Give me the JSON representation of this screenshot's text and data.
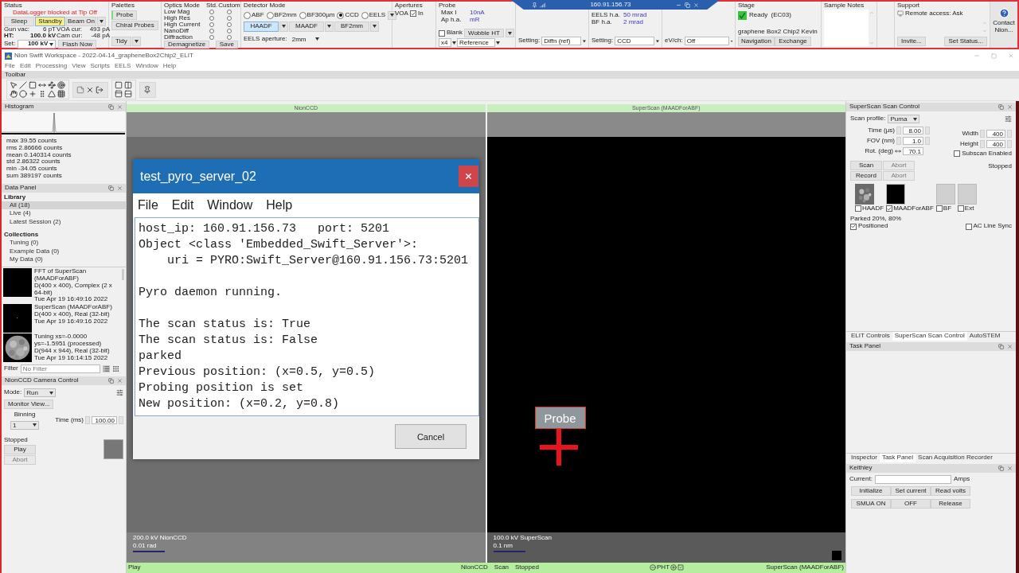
{
  "ribbon": {
    "status": {
      "title": "Status",
      "warning": "DataLogger blocked at Tip Off",
      "buttons": [
        {
          "label": "Sleep",
          "selected": false
        },
        {
          "label": "Standby",
          "selected": true
        },
        {
          "label": "Beam On",
          "selected": false
        }
      ],
      "readings": [
        {
          "label": "Gun vac:",
          "value": "6 pT",
          "bold": false
        },
        {
          "label": "VOA cur:",
          "value": "493 pA",
          "bold": false
        },
        {
          "label": "HT:",
          "value": "100.0 kV",
          "bold": true
        },
        {
          "label": "Cam cur:",
          "value": "-48 pA",
          "bold": false
        }
      ],
      "set_label": "Set:",
      "set_value": "100 kV",
      "flash": "Flash Now"
    },
    "palettes": {
      "title": "Palettes",
      "buttons": [
        "Probe",
        "Chiral Probes"
      ],
      "tidy": "Tidy"
    },
    "optics": {
      "title": "Optics Mode",
      "std": "Std.",
      "custom": "Custom",
      "modes": [
        {
          "label": "Low Mag",
          "std": false,
          "custom": false
        },
        {
          "label": "High Res",
          "std": false,
          "custom": false
        },
        {
          "label": "High Current",
          "std": false,
          "custom": false
        },
        {
          "label": "NanoDiff",
          "std": false,
          "custom": false
        },
        {
          "label": "Diffraction",
          "std": false,
          "custom": false
        }
      ],
      "buttons": [
        "Demagnetize",
        "Save"
      ]
    },
    "detector": {
      "title": "Detector Mode",
      "options": [
        {
          "label": "ABF",
          "selected": false
        },
        {
          "label": "BF2mm",
          "selected": false
        },
        {
          "label": "BF300µm",
          "selected": false
        },
        {
          "label": "CCD",
          "selected": true
        },
        {
          "label": "EELS",
          "selected": false
        }
      ],
      "detectors": [
        {
          "label": "HAADF",
          "selected": true
        },
        {
          "label": "MAADF",
          "selected": false
        },
        {
          "label": "BF2mm",
          "selected": false
        }
      ],
      "eels_label": "EELS aperture:",
      "eels_value": "2mm"
    },
    "apertures": {
      "title": "Apertures",
      "voa": "VOA",
      "checked": true,
      "state": "In"
    },
    "probe": {
      "title": "Probe",
      "rows": [
        {
          "label": "Max I",
          "value": "10nA"
        },
        {
          "label": "Ap h.a.",
          "value": "mR"
        }
      ],
      "blank": {
        "label": "Blank",
        "checked": false
      },
      "wobble": "Wobble HT",
      "mult": "x4",
      "reference": "Reference"
    },
    "setting_a": {
      "label": "Setting:",
      "value": "Diffn  (ref)"
    },
    "angles": [
      {
        "label": "EELS h.a.",
        "value": "50 mrad"
      },
      {
        "label": "BF h.a.",
        "value": "2 mrad"
      }
    ],
    "setting_b": {
      "label": "Setting:",
      "value": "CCD"
    },
    "setting_c": {
      "label": "eV/ch:",
      "value": "Off"
    },
    "stage": {
      "title": "Stage",
      "ready": true,
      "status": "Ready  (EC03)",
      "sample": "graphene Box2 Chip2 Kevin",
      "buttons": [
        "Navigation",
        "Exchange"
      ]
    },
    "sample_notes": {
      "title": "Sample Notes"
    },
    "support": {
      "title": "Support",
      "remote": "Remote access: Ask",
      "buttons": [
        "Invite...",
        "Set Status..."
      ]
    },
    "contact": "Contact Nion..."
  },
  "remote_bar": {
    "title": "160.91.156.73"
  },
  "window": {
    "title": "Nion Swift Workspace - 2022-04-14_grapheneBox2Chip2_ELIT",
    "menu": [
      "File",
      "Edit",
      "Processing",
      "View",
      "Scripts",
      "EELS",
      "Window",
      "Help"
    ]
  },
  "toolbar": {
    "title": "Toolbar"
  },
  "histogram": {
    "title": "Histogram",
    "stats": [
      "max 39.55 counts",
      "rms 2.86666 counts",
      "mean 0.140314 counts",
      "std 2.86322 counts",
      "min -34.05 counts",
      "sum 389197 counts"
    ]
  },
  "data_panel": {
    "title": "Data Panel",
    "library": "Library",
    "library_items": [
      {
        "label": "All (18)",
        "selected": true
      },
      {
        "label": "Live (4)",
        "selected": false
      },
      {
        "label": "Latest Session (2)",
        "selected": false
      }
    ],
    "collections": "Collections",
    "collection_items": [
      {
        "label": "Tuning (0)",
        "selected": false
      },
      {
        "label": "Example Data (0)",
        "selected": false
      },
      {
        "label": "My Data (0)",
        "selected": false
      }
    ],
    "items": [
      {
        "kind": "dark",
        "lines": [
          "FFT of SuperScan (MAADForABF)",
          "D(400 x 400), Complex (2 x 64-bit)",
          "Tue Apr 19 16:49:16 2022"
        ]
      },
      {
        "kind": "dot",
        "lines": [
          "SuperScan (MAADForABF)",
          "D(400 x 400), Real (32-bit)",
          "Tue Apr 19 16:49:16 2022"
        ]
      },
      {
        "kind": "picture",
        "lines": [
          "Tuning xs=-0.0000 ys=-1.5951 (processed)",
          "D(944 x 944), Real (32-bit)",
          "Tue Apr 19 16:14:15 2022"
        ]
      }
    ],
    "filter_label": "Filter",
    "filter_placeholder": "No Filter"
  },
  "camera": {
    "title": "NionCCD Camera Control",
    "mode_label": "Mode:",
    "mode": "Run",
    "monitor": "Monitor View...",
    "binning_label": "Binning",
    "binning": "1",
    "time_label": "Time (ms)",
    "time": "100.00",
    "state": "Stopped",
    "buttons": [
      {
        "label": "Play",
        "disabled": false
      },
      {
        "label": "Abort",
        "disabled": true
      }
    ]
  },
  "displays": [
    {
      "kind": "camera",
      "header": "NionCCD",
      "caption": "200.0 kV NionCCD",
      "scale": "0.01 rad"
    },
    {
      "kind": "scan",
      "header": "SuperScan (MAADForABF)",
      "caption": "100.0 kV SuperScan",
      "scale": "0.1 nm",
      "marker": "Probe"
    }
  ],
  "status_bar": {
    "left": "Play",
    "camera": "NionCCD",
    "scan": "Scan",
    "scan_state": "Stopped",
    "pmt": "PHT",
    "right": "SuperScan (MAADForABF)"
  },
  "dialog": {
    "title": "test_pyro_server_02",
    "menu": [
      "File",
      "Edit",
      "Window",
      "Help"
    ],
    "blocks": [
      [
        "host_ip: 160.91.156.73   port: 5201",
        "Object <class 'Embedded_Swift_Server'>:",
        "    uri = PYRO:Swift_Server@160.91.156.73:5201"
      ],
      [
        "Pyro daemon running."
      ],
      [
        "The scan status is: True",
        "The scan status is: False",
        "parked",
        "Previous position: (x=0.5, y=0.5)",
        "Probing position is set",
        "New position: (x=0.2, y=0.8)"
      ]
    ],
    "cancel": "Cancel"
  },
  "scan_control": {
    "title": "SuperScan Scan Control",
    "profile_label": "Scan profile:",
    "profile": "Puma",
    "fields": [
      {
        "label": "Time (µs)",
        "value": "8.00"
      },
      {
        "label": "FOV (nm)",
        "value": "1.0"
      },
      {
        "label": "Rot. (deg)",
        "value": "70.1"
      }
    ],
    "size_fields": [
      {
        "label": "Width",
        "value": "400"
      },
      {
        "label": "Height",
        "value": "400"
      }
    ],
    "subscan": {
      "label": "Subscan Enabled",
      "checked": false
    },
    "buttons": [
      {
        "label": "Scan",
        "disabled": false
      },
      {
        "label": "Abort",
        "disabled": true
      },
      {
        "label": "Record",
        "disabled": false
      },
      {
        "label": "Abort",
        "disabled": true
      }
    ],
    "state": "Stopped",
    "channels": [
      {
        "label": "HAADF",
        "checked": false,
        "kind": "picture"
      },
      {
        "label": "MAADForABF",
        "checked": true,
        "kind": "dark"
      },
      {
        "label": "BF",
        "checked": false,
        "kind": "empty"
      },
      {
        "label": "Ext",
        "checked": false,
        "kind": "empty"
      }
    ],
    "parked": "Parked 20%, 80%",
    "positioned": {
      "label": "Positioned",
      "checked": true
    },
    "ac_sync": {
      "label": "AC Line Sync",
      "checked": false
    }
  },
  "right_tabs_top": [
    {
      "label": "ELIT Controls",
      "selected": false
    },
    {
      "label": "SuperScan Scan Control",
      "selected": true
    },
    {
      "label": "AutoSTEM",
      "selected": false
    }
  ],
  "task_panel": {
    "title": "Task Panel"
  },
  "right_tabs_bottom": [
    {
      "label": "Inspector",
      "selected": false
    },
    {
      "label": "Task Panel",
      "selected": true
    },
    {
      "label": "Scan Acquisition Recorder",
      "selected": false
    }
  ],
  "keithley": {
    "title": "Keithley",
    "current_label": "Current:",
    "unit": "Amps",
    "buttons": [
      "Initialize",
      "Set current",
      "Read volts",
      "SMUA ON",
      "OFF",
      "Release"
    ]
  }
}
